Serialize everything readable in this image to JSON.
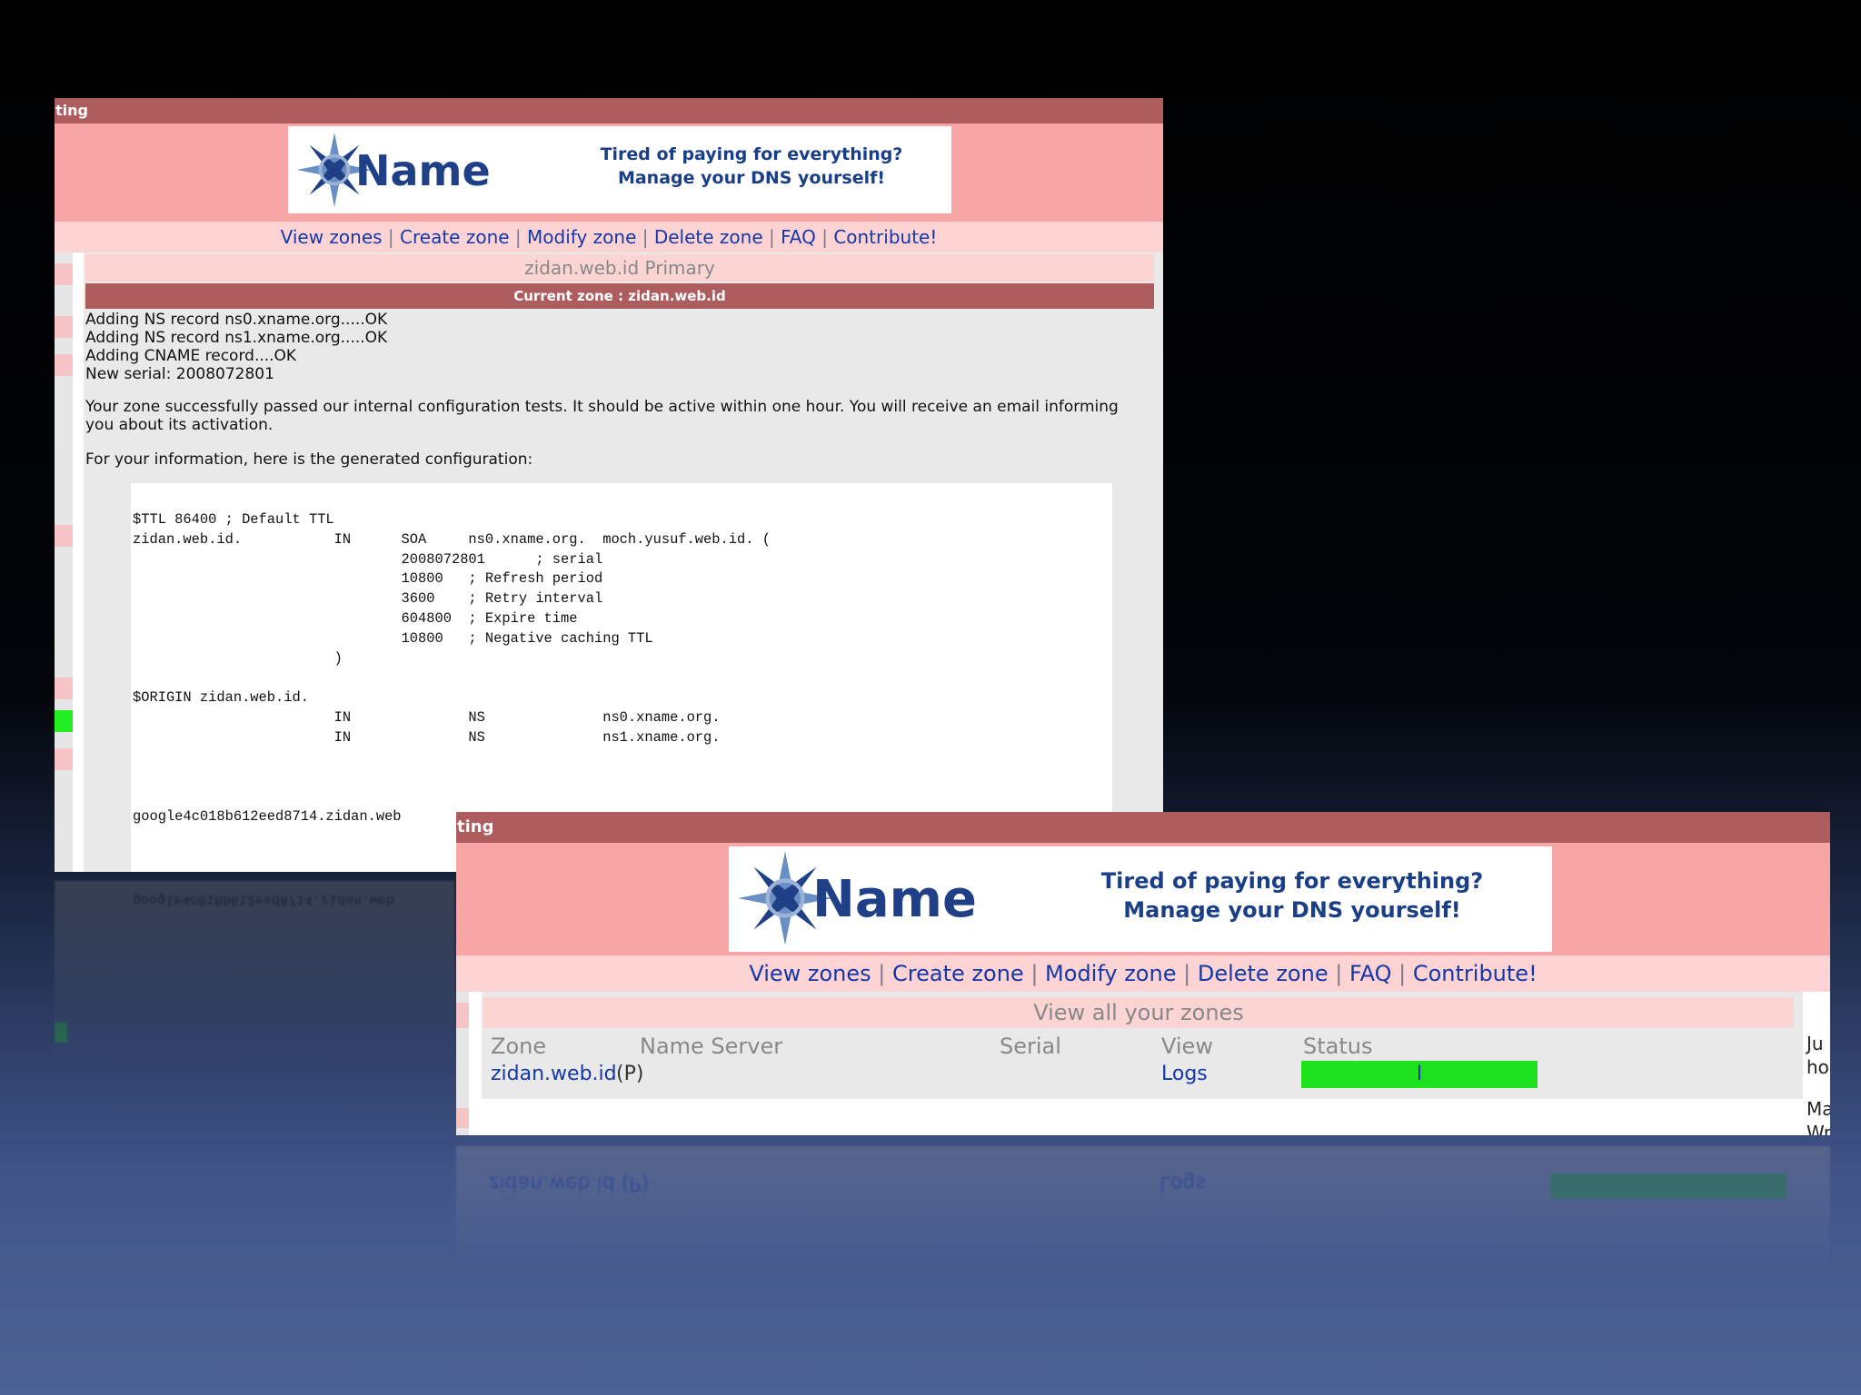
{
  "window_title_fragment": "ting",
  "brand": {
    "logo_text": "Name",
    "tagline_line1": "Tired of paying for everything?",
    "tagline_line2": "Manage your DNS yourself!"
  },
  "nav": [
    {
      "label": "View zones"
    },
    {
      "label": "Create zone"
    },
    {
      "label": "Modify zone"
    },
    {
      "label": "Delete zone"
    },
    {
      "label": "FAQ"
    },
    {
      "label": "Contribute!"
    }
  ],
  "nav_separator": "|",
  "modify_screen": {
    "page_heading": "zidan.web.id Primary",
    "current_zone_bar": "Current zone : zidan.web.id",
    "log_lines": [
      "Adding NS record ns0.xname.org.....OK",
      "Adding NS record ns1.xname.org.....OK",
      "Adding CNAME record....OK",
      "New serial: 2008072801"
    ],
    "success_message": "Your zone successfully passed our internal configuration tests. It should be active within one hour. You will receive an email informing you about its activation.",
    "config_intro": "For your information, here is the generated configuration:",
    "config_lines": [
      "$TTL 86400 ; Default TTL",
      "zidan.web.id.           IN      SOA     ns0.xname.org.  moch.yusuf.web.id. (",
      "                                2008072801      ; serial",
      "                                10800   ; Refresh period",
      "                                3600    ; Retry interval",
      "                                604800  ; Expire time",
      "                                10800   ; Negative caching TTL",
      "                        )",
      "",
      "$ORIGIN zidan.web.id.",
      "                        IN              NS              ns0.xname.org.",
      "                        IN              NS              ns1.xname.org.",
      "",
      "",
      "",
      "google4c018b612eed8714.zidan.web"
    ]
  },
  "zones_screen": {
    "page_heading": "View all your zones",
    "columns": [
      "Zone",
      "Name Server",
      "Serial",
      "View",
      "Status"
    ],
    "rows": [
      {
        "zone": "zidan.web.id",
        "zone_type": "(P)",
        "name_server": "",
        "serial": "",
        "view": "Logs",
        "status_color": "#1de11d",
        "status_mark": "I"
      }
    ],
    "side_text": [
      "Ju",
      "ho",
      "Ma",
      "Wr"
    ]
  },
  "colors": {
    "topbar": "#ae5d5f",
    "header_bg": "#f7a6a5",
    "nav_bg": "#fdd3d3",
    "link": "#1537a8",
    "status_ok": "#1de11d"
  },
  "icons": {
    "logo_star": "compass-star-icon"
  }
}
